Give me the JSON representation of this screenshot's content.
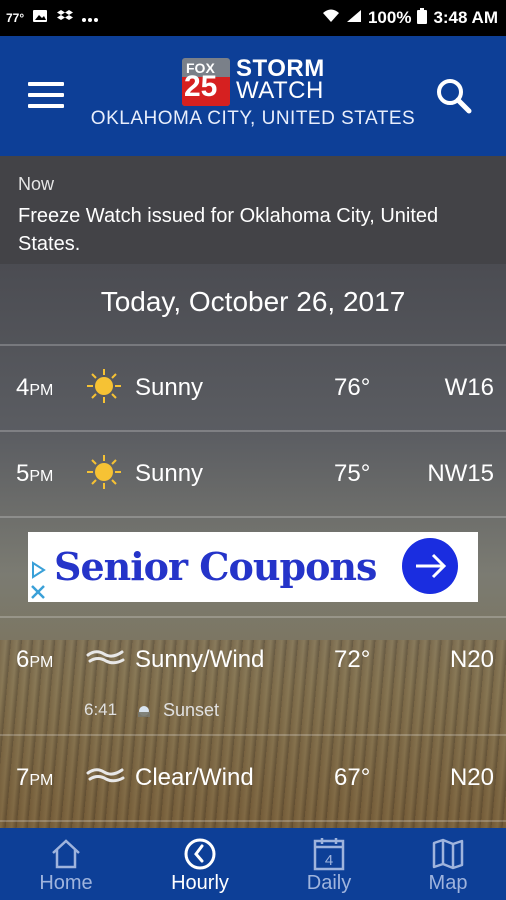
{
  "status_bar": {
    "temp": "77°",
    "battery": "100%",
    "time": "3:48 AM"
  },
  "header": {
    "logo_fox": "FOX",
    "logo_num": "25",
    "logo_line1": "STORM",
    "logo_line2": "WATCH",
    "location": "OKLAHOMA CITY, UNITED STATES"
  },
  "alert": {
    "time": "Now",
    "text": "Freeze Watch issued for Oklahoma City, United States."
  },
  "date": "Today, October 26, 2017",
  "hours": [
    {
      "hour": "4",
      "ampm": "PM",
      "icon": "sun-icon",
      "condition": "Sunny",
      "temp": "76°",
      "wind": "W16"
    },
    {
      "hour": "5",
      "ampm": "PM",
      "icon": "sun-icon",
      "condition": "Sunny",
      "temp": "75°",
      "wind": "NW15"
    },
    {
      "hour": "6",
      "ampm": "PM",
      "icon": "wind-icon",
      "condition": "Sunny/Wind",
      "temp": "72°",
      "wind": "N20"
    },
    {
      "hour": "7",
      "ampm": "PM",
      "icon": "wind-icon",
      "condition": "Clear/Wind",
      "temp": "67°",
      "wind": "N20"
    }
  ],
  "sunset": {
    "time": "6:41",
    "label": "Sunset"
  },
  "ad": {
    "text": "Senior Coupons"
  },
  "nav": {
    "items": [
      {
        "label": "Home",
        "icon": "home-icon"
      },
      {
        "label": "Hourly",
        "icon": "clock-icon"
      },
      {
        "label": "Daily",
        "icon": "calendar-icon",
        "badge": "4"
      },
      {
        "label": "Map",
        "icon": "map-icon"
      }
    ],
    "active": "Hourly"
  },
  "colors": {
    "header_bg": "#0d3f97",
    "sun": "#f6c234",
    "ad_blue": "#1a2de0"
  }
}
